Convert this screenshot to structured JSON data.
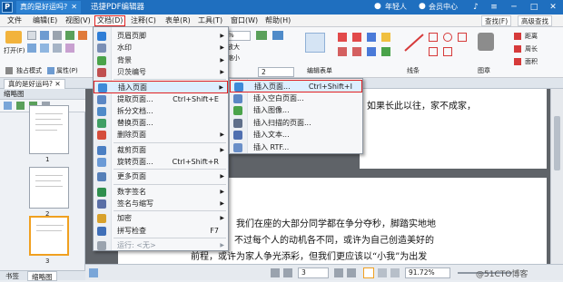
{
  "titlebar": {
    "logo": "P",
    "doc_tab": "真的是好运吗?",
    "app_title": "迅捷PDF编辑器",
    "user": "年轻人",
    "member": "会员中心",
    "icons": [
      "bell-icon",
      "menu-icon",
      "minimize-icon",
      "maximize-icon",
      "close-icon"
    ]
  },
  "menubar": {
    "items": [
      "文件",
      "编辑(E)",
      "视图(V)",
      "文档(D)",
      "注释(C)",
      "表单(R)",
      "工具(T)",
      "窗口(W)",
      "帮助(H)"
    ],
    "active": "文档(D)",
    "find": "查找(F)",
    "advanced_find": "高级查找"
  },
  "toolbar": {
    "open": "打开(F)",
    "solo_mode": "独占模式",
    "properties": "属性(P)",
    "zoom": "%",
    "zoom_in": "放大",
    "zoom_out": "缩小",
    "page_number": "2",
    "edit_form": "编辑表单",
    "line": "线条",
    "shape": "图章",
    "distance": "距离",
    "perimeter": "周长",
    "area": "面积"
  },
  "doc_tab": "真的是好运吗?",
  "left_panel": {
    "header": "缩略图",
    "thumbnails": [
      "1",
      "2",
      "3"
    ],
    "bottom_tabs": [
      "书签",
      "缩略图"
    ]
  },
  "document": {
    "page1_line": "如果长此以往，家不成家，",
    "page2_lines": [
      "我们在座的大部分同学都在争分夺秒，脚踏实地地",
      "，不过每个人的动机各不同，或许为自己创造美好的",
      "前程，或许为家人争光添彩，但我们更应该以“小我”为出发"
    ]
  },
  "status": {
    "page": "3",
    "zoom": "91.72%",
    "watermark": "@51CTO博客"
  },
  "document_menu": {
    "items": [
      {
        "label": "页眉页脚",
        "arrow": true,
        "color": "#2e7dd6"
      },
      {
        "label": "水印",
        "arrow": true,
        "color": "#7a8fb5"
      },
      {
        "label": "背景",
        "arrow": true,
        "color": "#4aa34a"
      },
      {
        "label": "贝茨编号",
        "arrow": true,
        "color": "#c05050"
      },
      {
        "label": "插入页面",
        "arrow": true,
        "highlight": true,
        "color": "#3d8ad8"
      },
      {
        "label": "提取页面...",
        "shortcut": "Ctrl+Shift+E",
        "color": "#5b87c4"
      },
      {
        "label": "拆分文档...",
        "color": "#4f8bc9"
      },
      {
        "label": "替换页面...",
        "color": "#3f9f64"
      },
      {
        "label": "删除页面",
        "arrow": true,
        "color": "#d54d3c"
      },
      {
        "label": "裁剪页面",
        "arrow": true,
        "color": "#4b7fc3"
      },
      {
        "label": "旋转页面...",
        "shortcut": "Ctrl+Shift+R",
        "color": "#6a9ad6"
      },
      {
        "label": "更多页面",
        "arrow": true,
        "color": "#557fb8"
      },
      {
        "label": "数字签名",
        "arrow": true,
        "color": "#2f8f4e"
      },
      {
        "label": "签名与缩写",
        "arrow": true,
        "color": "#5a6fa6"
      },
      {
        "label": "加密",
        "arrow": true,
        "color": "#d8a12b"
      },
      {
        "label": "拼写检查",
        "shortcut": "F7",
        "color": "#3f6fb8"
      },
      {
        "label": "运行: <无>",
        "arrow": true,
        "disabled": true,
        "color": "#9aa3ae"
      }
    ],
    "separators_after": [
      3,
      8,
      10,
      11,
      13,
      15
    ]
  },
  "insert_submenu": {
    "items": [
      {
        "label": "插入页面...",
        "shortcut": "Ctrl+Shift+I",
        "highlight": true,
        "color": "#3d8ad8"
      },
      {
        "label": "插入空白页面...",
        "color": "#5b87c4"
      },
      {
        "label": "插入图像...",
        "color": "#4aa34a"
      },
      {
        "label": "插入扫描的页面...",
        "color": "#5f6f8a"
      },
      {
        "label": "插入文本...",
        "color": "#4f6fb0"
      },
      {
        "label": "插入 RTF...",
        "color": "#6a8fc8"
      }
    ]
  }
}
